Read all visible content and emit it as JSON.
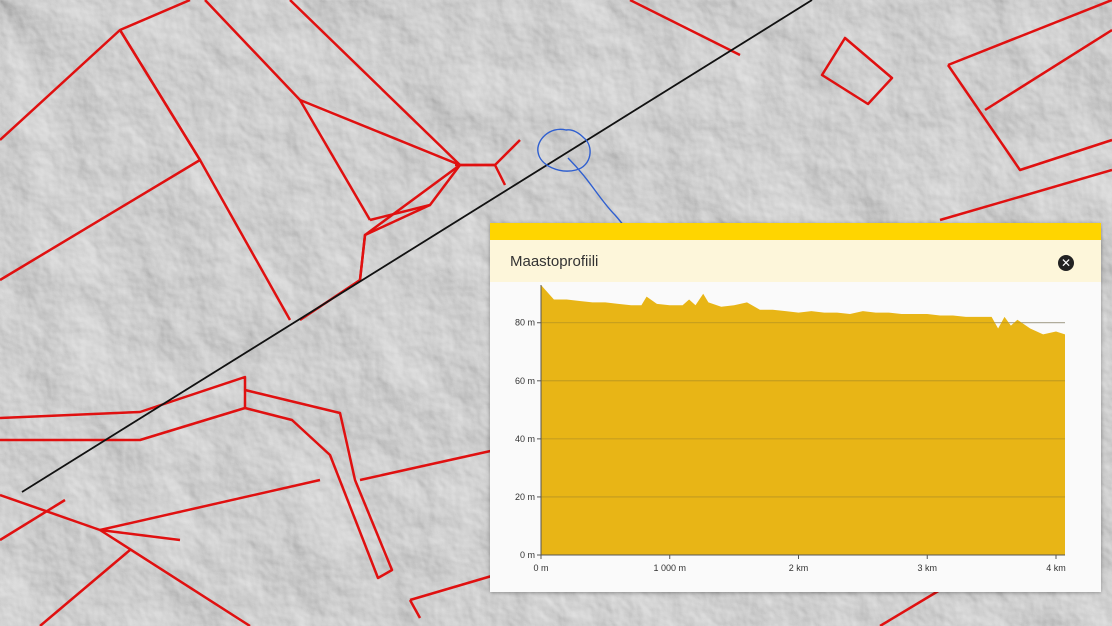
{
  "map": {
    "background": "#b9b9b9",
    "parcel_color": "#e01010",
    "profile_line_color": "#111111",
    "annotation_color": "#2f5fd0"
  },
  "profile_panel": {
    "title": "Maastoprofiili",
    "close_icon": "close-icon",
    "accent": "#ffd500",
    "header_bg": "#fdf6da",
    "fill_color": "#e8b516"
  },
  "chart_data": {
    "type": "area",
    "title": "",
    "xlabel": "",
    "ylabel": "",
    "x_tick_labels": [
      "0 m",
      "1 000 m",
      "2 km",
      "3 km",
      "4 km"
    ],
    "x_ticks": [
      0,
      1000,
      2000,
      3000,
      4000
    ],
    "y_tick_labels": [
      "0 m",
      "20 m",
      "40 m",
      "60 m",
      "80 m"
    ],
    "y_ticks": [
      0,
      20,
      40,
      60,
      80
    ],
    "xlim": [
      0,
      4070
    ],
    "ylim": [
      0,
      93
    ],
    "grid": true,
    "series": [
      {
        "x": [
          0,
          40,
          100,
          200,
          300,
          400,
          500,
          600,
          700,
          780,
          820,
          900,
          1000,
          1100,
          1150,
          1200,
          1260,
          1300,
          1400,
          1500,
          1600,
          1700,
          1800,
          1900,
          2000,
          2100,
          2200,
          2300,
          2400,
          2500,
          2600,
          2700,
          2800,
          2900,
          3000,
          3100,
          3200,
          3300,
          3400,
          3500,
          3550,
          3600,
          3650,
          3700,
          3800,
          3900,
          4000,
          4070
        ],
        "y": [
          93,
          91,
          88,
          88,
          87.5,
          87,
          87,
          86.5,
          86,
          86,
          89,
          86.5,
          86,
          86,
          88,
          86,
          90,
          87,
          85.5,
          86,
          87,
          84.5,
          84.5,
          84,
          83.5,
          84,
          83.5,
          83.5,
          83,
          84,
          83.5,
          83.5,
          83,
          83,
          83,
          82.5,
          82.5,
          82,
          82,
          82,
          78,
          82,
          79,
          81,
          78,
          76,
          77,
          76
        ]
      }
    ]
  }
}
